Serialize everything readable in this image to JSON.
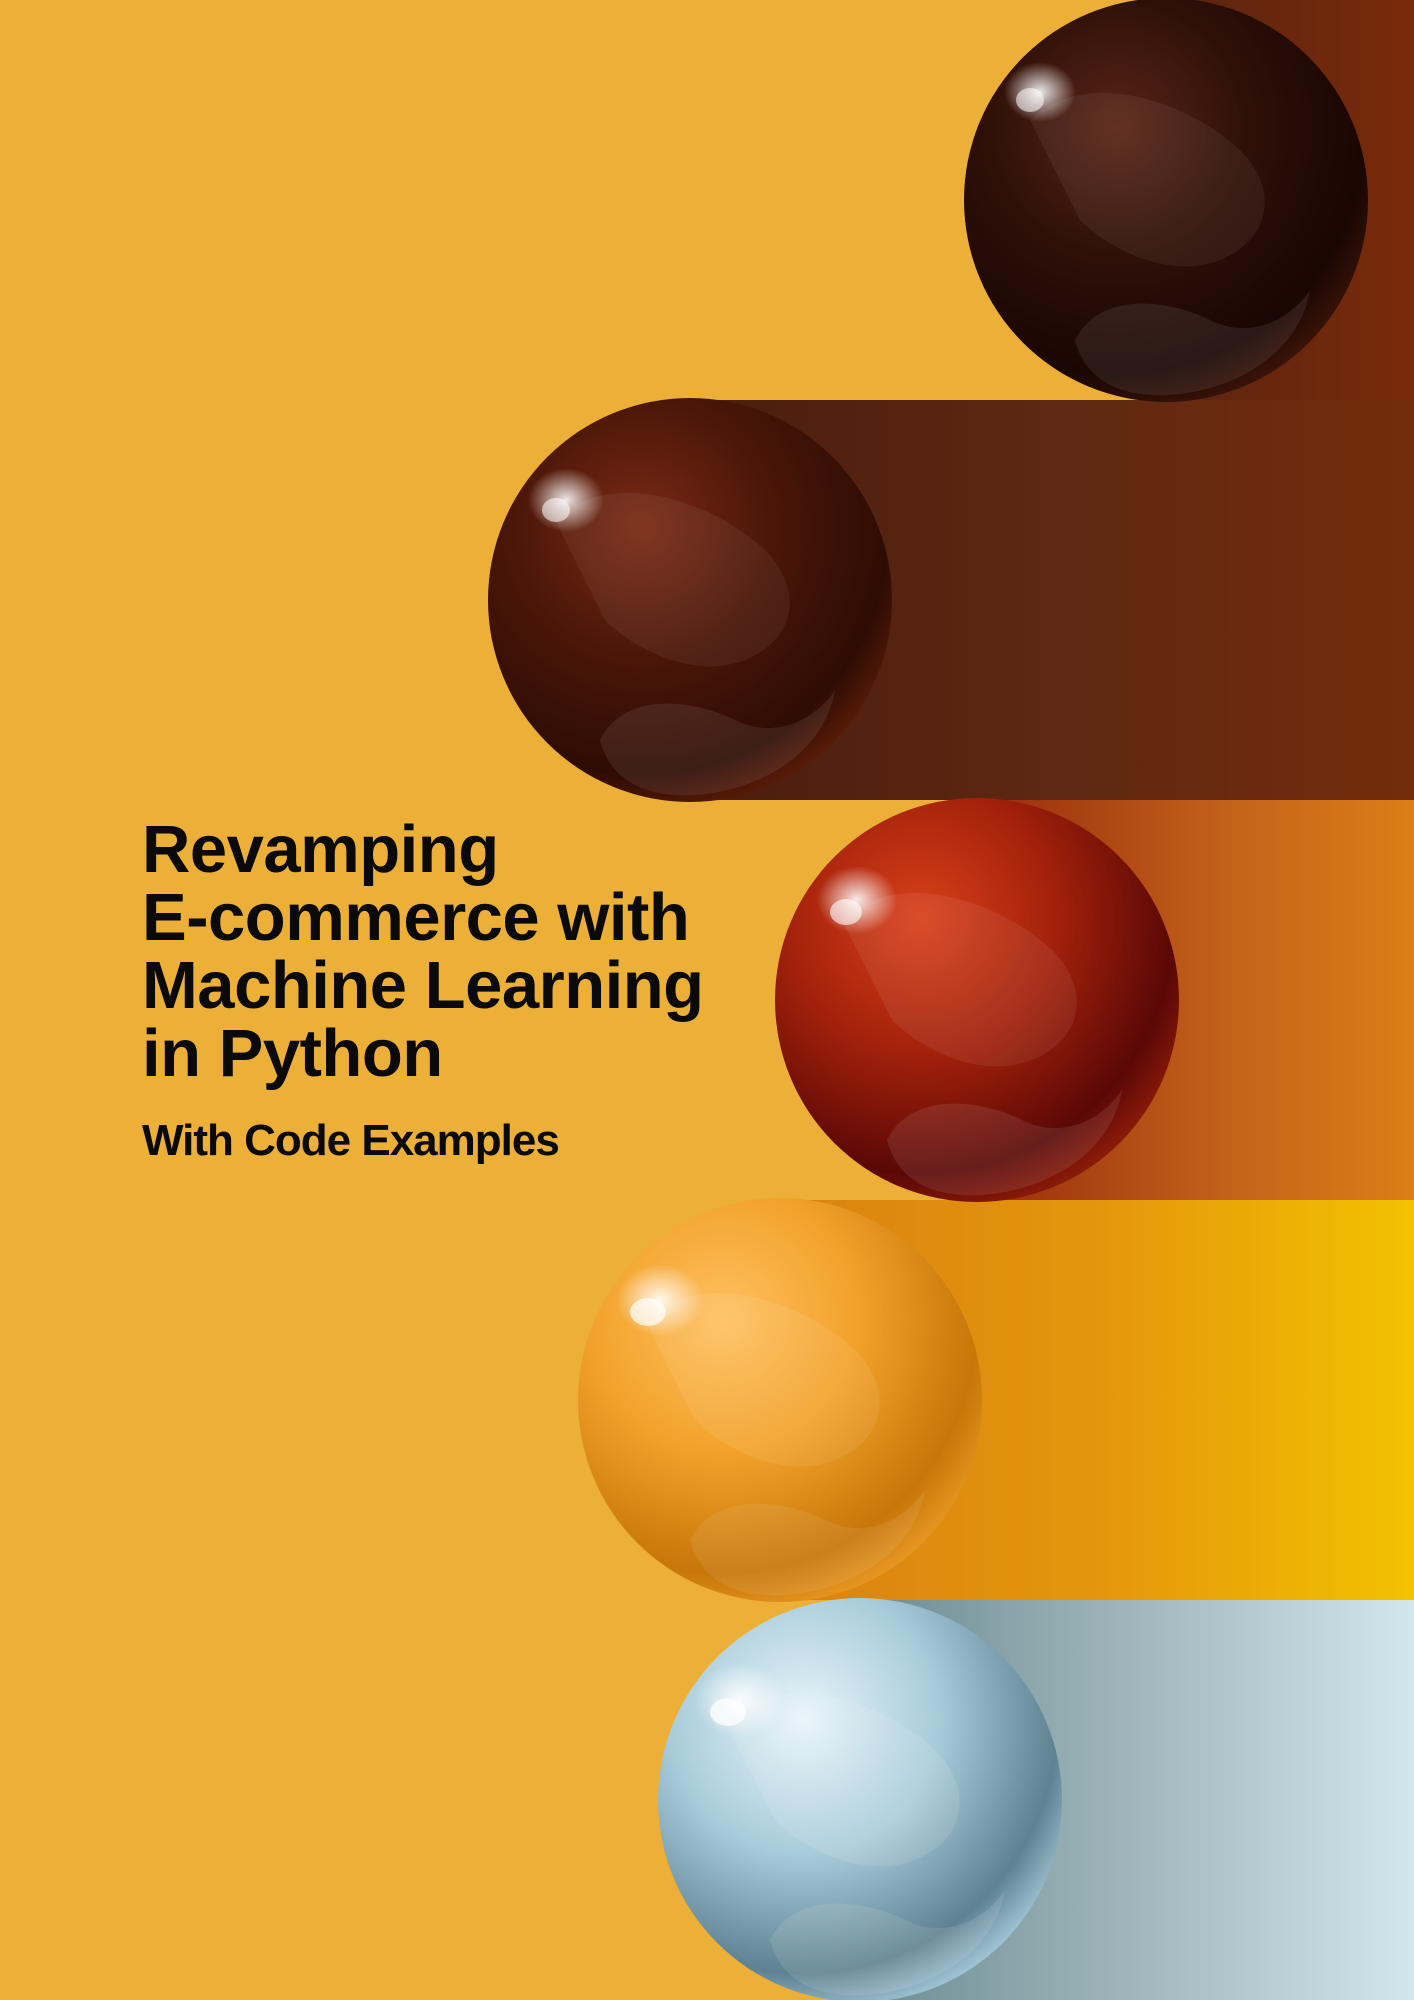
{
  "cover": {
    "title_lines": [
      "Revamping",
      "E-commerce with",
      "Machine Learning",
      "in Python"
    ],
    "subtitle": "With Code Examples"
  },
  "colors": {
    "background": "#ECAF37",
    "title_text": "#0A0A0A",
    "sphere_1": "#2A0E05",
    "sphere_2": "#4A1607",
    "sphere_3": "#A3210B",
    "sphere_4": "#F0A030",
    "sphere_5": "#A8CCDA"
  }
}
